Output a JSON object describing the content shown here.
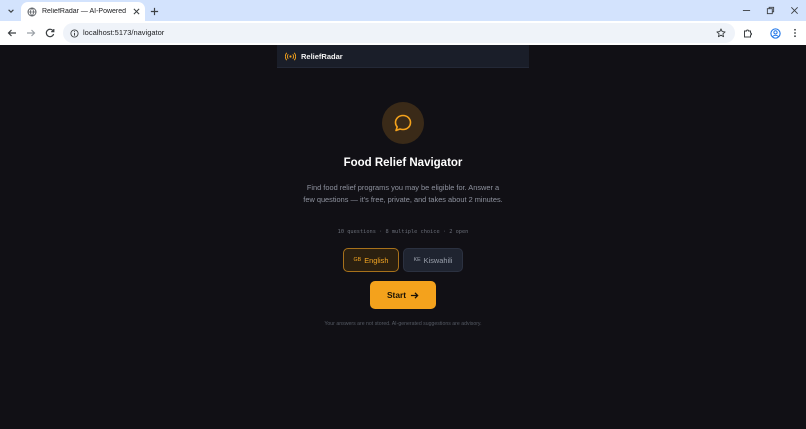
{
  "browser": {
    "tab": {
      "title": "ReliefRadar — AI-Powered Food"
    },
    "url": "localhost:5173/navigator"
  },
  "app": {
    "brand": "ReliefRadar",
    "title": "Food Relief Navigator",
    "description": "Find food relief programs you may be eligible for. Answer a few questions — it's free, private, and takes about 2 minutes.",
    "meta": "10 questions · 8 multiple choice · 2 open",
    "languages": [
      {
        "code": "GB",
        "label": "English",
        "selected": true
      },
      {
        "code": "KE",
        "label": "Kiswahili",
        "selected": false
      }
    ],
    "start_label": "Start",
    "footnote": "Your answers are not stored. AI-generated suggestions are advisory."
  },
  "colors": {
    "accent": "#f4a21c",
    "background": "#111015",
    "tabstrip": "#d3e3fd"
  }
}
